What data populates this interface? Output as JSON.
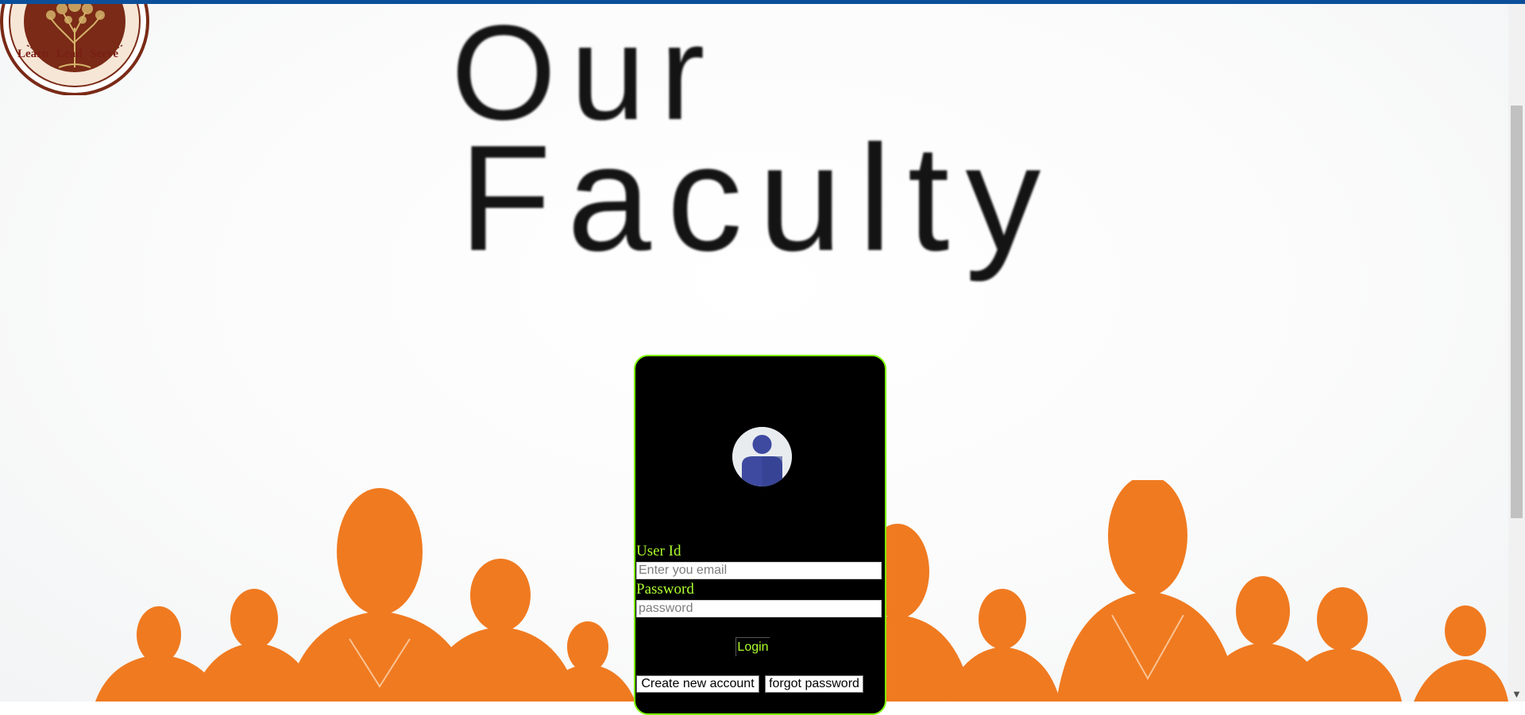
{
  "hero": {
    "line1": "Our",
    "line2": "Faculty"
  },
  "logo": {
    "motto": "Learn Lead Serve"
  },
  "login": {
    "user_label": "User Id",
    "user_placeholder": "Enter you email",
    "password_label": "Password",
    "password_placeholder": "password",
    "login_button": "Login",
    "create_account_button": "Create new account",
    "forgot_password_button": "forgot password",
    "avatar_icon": "user-avatar-icon"
  },
  "colors": {
    "accent": "#adff2f",
    "card_border": "#7fff00",
    "card_background": "#000000",
    "crowd": "#f07a20",
    "top_strip": "#0b4f9b"
  }
}
